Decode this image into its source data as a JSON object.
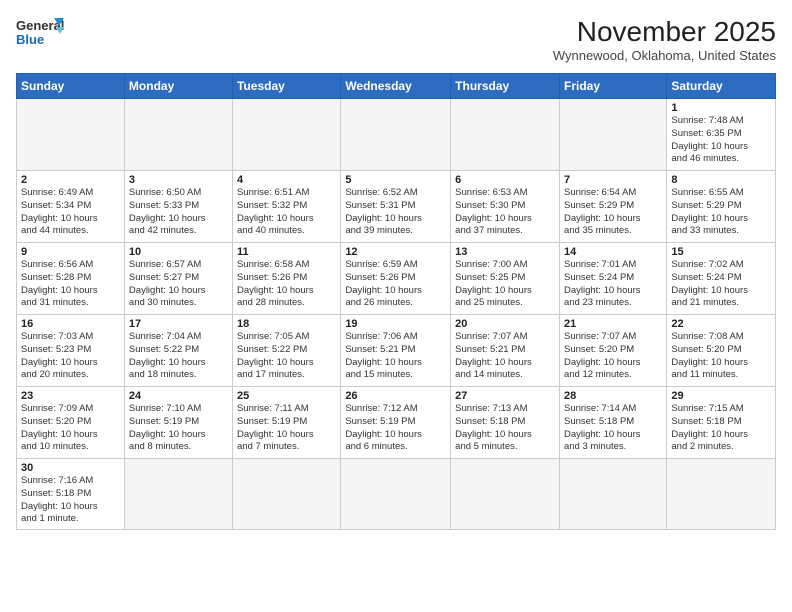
{
  "header": {
    "logo_text_general": "General",
    "logo_text_blue": "Blue",
    "month_title": "November 2025",
    "location": "Wynnewood, Oklahoma, United States"
  },
  "days_of_week": [
    "Sunday",
    "Monday",
    "Tuesday",
    "Wednesday",
    "Thursday",
    "Friday",
    "Saturday"
  ],
  "weeks": [
    [
      {
        "day": "",
        "info": "",
        "empty": true
      },
      {
        "day": "",
        "info": "",
        "empty": true
      },
      {
        "day": "",
        "info": "",
        "empty": true
      },
      {
        "day": "",
        "info": "",
        "empty": true
      },
      {
        "day": "",
        "info": "",
        "empty": true
      },
      {
        "day": "",
        "info": "",
        "empty": true
      },
      {
        "day": "1",
        "info": "Sunrise: 7:48 AM\nSunset: 6:35 PM\nDaylight: 10 hours\nand 46 minutes.",
        "empty": false
      }
    ],
    [
      {
        "day": "2",
        "info": "Sunrise: 6:49 AM\nSunset: 5:34 PM\nDaylight: 10 hours\nand 44 minutes.",
        "empty": false
      },
      {
        "day": "3",
        "info": "Sunrise: 6:50 AM\nSunset: 5:33 PM\nDaylight: 10 hours\nand 42 minutes.",
        "empty": false
      },
      {
        "day": "4",
        "info": "Sunrise: 6:51 AM\nSunset: 5:32 PM\nDaylight: 10 hours\nand 40 minutes.",
        "empty": false
      },
      {
        "day": "5",
        "info": "Sunrise: 6:52 AM\nSunset: 5:31 PM\nDaylight: 10 hours\nand 39 minutes.",
        "empty": false
      },
      {
        "day": "6",
        "info": "Sunrise: 6:53 AM\nSunset: 5:30 PM\nDaylight: 10 hours\nand 37 minutes.",
        "empty": false
      },
      {
        "day": "7",
        "info": "Sunrise: 6:54 AM\nSunset: 5:29 PM\nDaylight: 10 hours\nand 35 minutes.",
        "empty": false
      },
      {
        "day": "8",
        "info": "Sunrise: 6:55 AM\nSunset: 5:29 PM\nDaylight: 10 hours\nand 33 minutes.",
        "empty": false
      }
    ],
    [
      {
        "day": "9",
        "info": "Sunrise: 6:56 AM\nSunset: 5:28 PM\nDaylight: 10 hours\nand 31 minutes.",
        "empty": false
      },
      {
        "day": "10",
        "info": "Sunrise: 6:57 AM\nSunset: 5:27 PM\nDaylight: 10 hours\nand 30 minutes.",
        "empty": false
      },
      {
        "day": "11",
        "info": "Sunrise: 6:58 AM\nSunset: 5:26 PM\nDaylight: 10 hours\nand 28 minutes.",
        "empty": false
      },
      {
        "day": "12",
        "info": "Sunrise: 6:59 AM\nSunset: 5:26 PM\nDaylight: 10 hours\nand 26 minutes.",
        "empty": false
      },
      {
        "day": "13",
        "info": "Sunrise: 7:00 AM\nSunset: 5:25 PM\nDaylight: 10 hours\nand 25 minutes.",
        "empty": false
      },
      {
        "day": "14",
        "info": "Sunrise: 7:01 AM\nSunset: 5:24 PM\nDaylight: 10 hours\nand 23 minutes.",
        "empty": false
      },
      {
        "day": "15",
        "info": "Sunrise: 7:02 AM\nSunset: 5:24 PM\nDaylight: 10 hours\nand 21 minutes.",
        "empty": false
      }
    ],
    [
      {
        "day": "16",
        "info": "Sunrise: 7:03 AM\nSunset: 5:23 PM\nDaylight: 10 hours\nand 20 minutes.",
        "empty": false
      },
      {
        "day": "17",
        "info": "Sunrise: 7:04 AM\nSunset: 5:22 PM\nDaylight: 10 hours\nand 18 minutes.",
        "empty": false
      },
      {
        "day": "18",
        "info": "Sunrise: 7:05 AM\nSunset: 5:22 PM\nDaylight: 10 hours\nand 17 minutes.",
        "empty": false
      },
      {
        "day": "19",
        "info": "Sunrise: 7:06 AM\nSunset: 5:21 PM\nDaylight: 10 hours\nand 15 minutes.",
        "empty": false
      },
      {
        "day": "20",
        "info": "Sunrise: 7:07 AM\nSunset: 5:21 PM\nDaylight: 10 hours\nand 14 minutes.",
        "empty": false
      },
      {
        "day": "21",
        "info": "Sunrise: 7:07 AM\nSunset: 5:20 PM\nDaylight: 10 hours\nand 12 minutes.",
        "empty": false
      },
      {
        "day": "22",
        "info": "Sunrise: 7:08 AM\nSunset: 5:20 PM\nDaylight: 10 hours\nand 11 minutes.",
        "empty": false
      }
    ],
    [
      {
        "day": "23",
        "info": "Sunrise: 7:09 AM\nSunset: 5:20 PM\nDaylight: 10 hours\nand 10 minutes.",
        "empty": false
      },
      {
        "day": "24",
        "info": "Sunrise: 7:10 AM\nSunset: 5:19 PM\nDaylight: 10 hours\nand 8 minutes.",
        "empty": false
      },
      {
        "day": "25",
        "info": "Sunrise: 7:11 AM\nSunset: 5:19 PM\nDaylight: 10 hours\nand 7 minutes.",
        "empty": false
      },
      {
        "day": "26",
        "info": "Sunrise: 7:12 AM\nSunset: 5:19 PM\nDaylight: 10 hours\nand 6 minutes.",
        "empty": false
      },
      {
        "day": "27",
        "info": "Sunrise: 7:13 AM\nSunset: 5:18 PM\nDaylight: 10 hours\nand 5 minutes.",
        "empty": false
      },
      {
        "day": "28",
        "info": "Sunrise: 7:14 AM\nSunset: 5:18 PM\nDaylight: 10 hours\nand 3 minutes.",
        "empty": false
      },
      {
        "day": "29",
        "info": "Sunrise: 7:15 AM\nSunset: 5:18 PM\nDaylight: 10 hours\nand 2 minutes.",
        "empty": false
      }
    ],
    [
      {
        "day": "30",
        "info": "Sunrise: 7:16 AM\nSunset: 5:18 PM\nDaylight: 10 hours\nand 1 minute.",
        "empty": false
      },
      {
        "day": "",
        "info": "",
        "empty": true
      },
      {
        "day": "",
        "info": "",
        "empty": true
      },
      {
        "day": "",
        "info": "",
        "empty": true
      },
      {
        "day": "",
        "info": "",
        "empty": true
      },
      {
        "day": "",
        "info": "",
        "empty": true
      },
      {
        "day": "",
        "info": "",
        "empty": true
      }
    ]
  ]
}
